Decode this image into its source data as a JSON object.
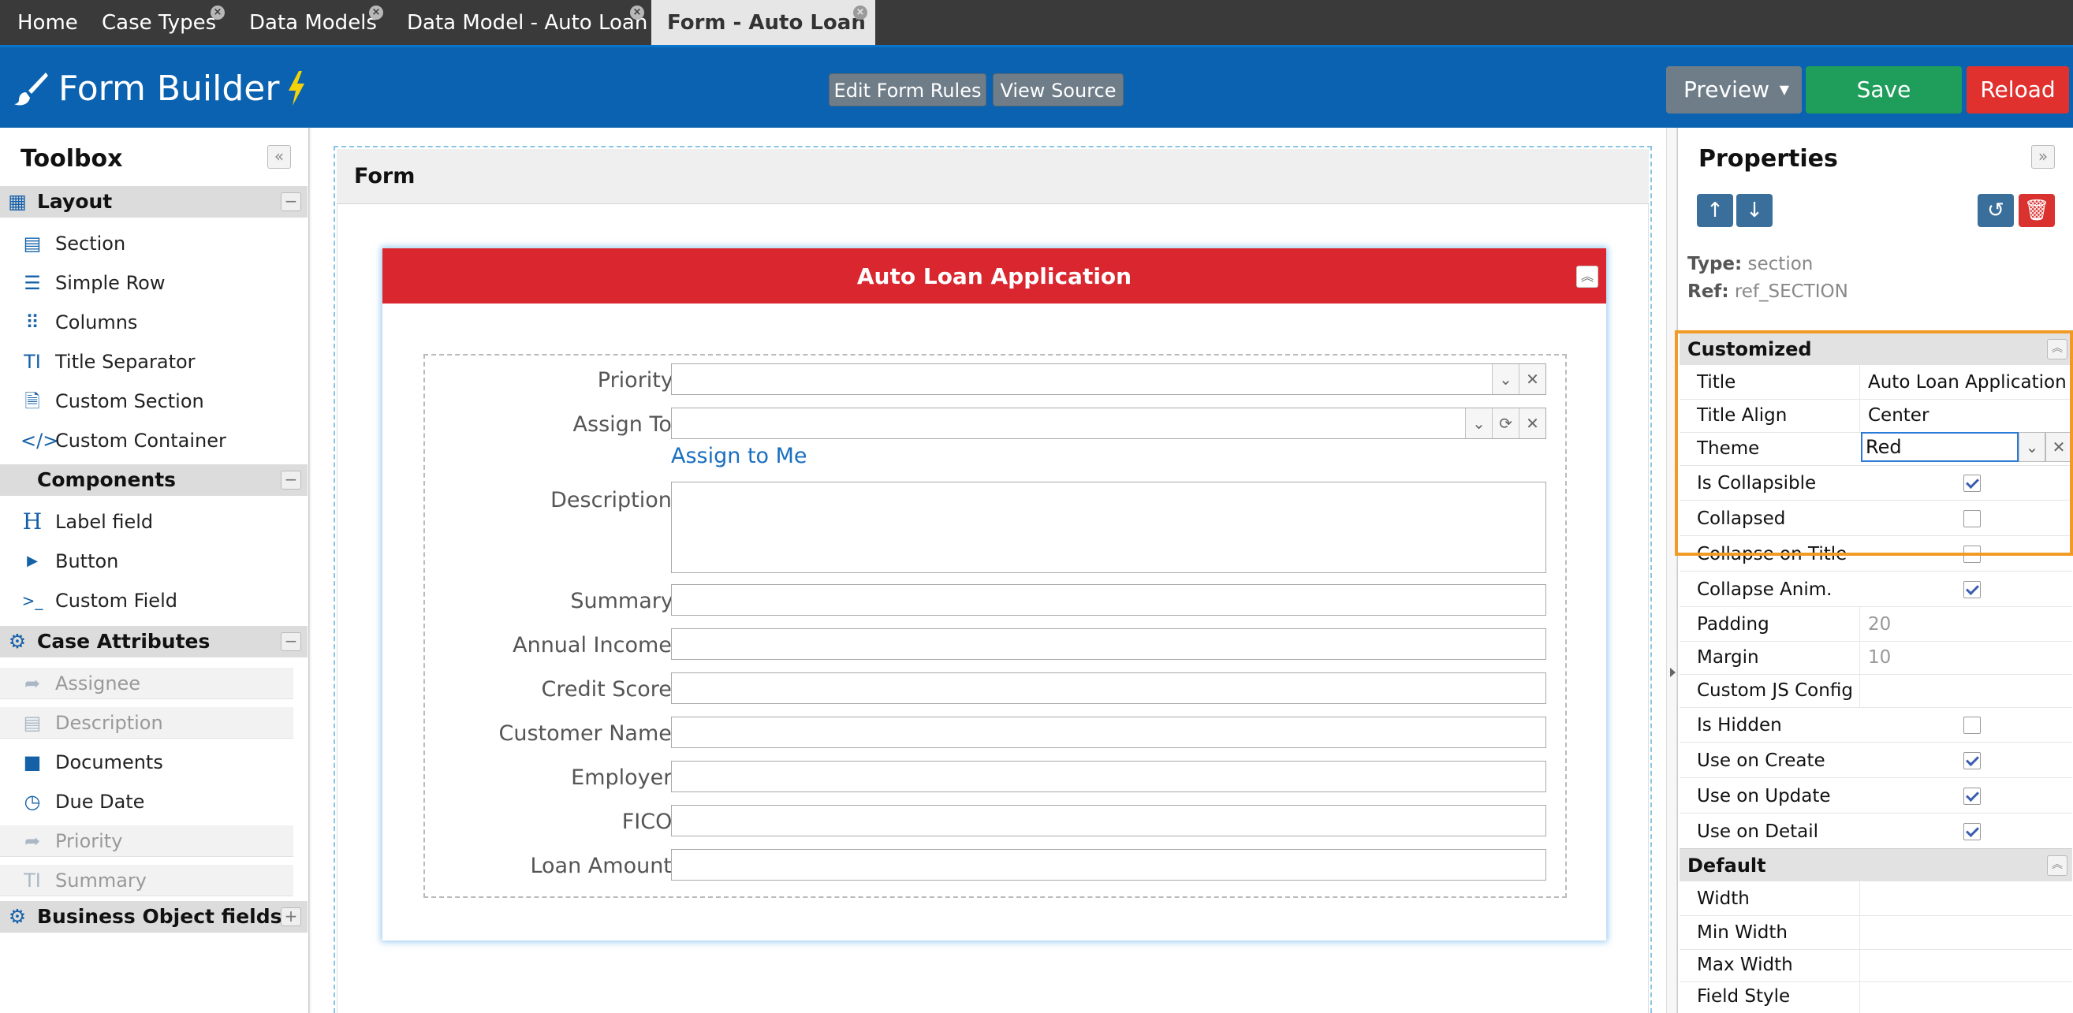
{
  "tabs": [
    {
      "label": "Home"
    },
    {
      "label": "Case Types"
    },
    {
      "label": "Data Models"
    },
    {
      "label": "Data Model - Auto Loan"
    },
    {
      "label": "Form - Auto Loan"
    }
  ],
  "header": {
    "title": "Form Builder",
    "edit_rules": "Edit Form Rules",
    "view_source": "View Source",
    "preview": "Preview",
    "save": "Save",
    "reload": "Reload",
    "colors": {
      "bar": "#0a62b0",
      "save": "#1f9e5b",
      "reload": "#e0312f",
      "preview": "#6f7d89"
    }
  },
  "toolbox": {
    "title": "Toolbox",
    "groups": {
      "layout": {
        "label": "Layout",
        "items": [
          "Section",
          "Simple Row",
          "Columns",
          "Title Separator",
          "Custom Section",
          "Custom Container"
        ]
      },
      "components": {
        "label": "Components",
        "items": [
          "Label field",
          "Button",
          "Custom Field"
        ]
      },
      "case_attributes": {
        "label": "Case Attributes",
        "items": [
          "Assignee",
          "Description",
          "Documents",
          "Due Date",
          "Priority",
          "Summary"
        ]
      },
      "business_object": {
        "label": "Business Object fields"
      }
    }
  },
  "form": {
    "header": "Form",
    "section_title": "Auto Loan Application",
    "section_color": "#d9262f",
    "fields": {
      "priority": "Priority:",
      "assign_to": "Assign To:",
      "assign_to_me": "Assign to Me",
      "description": "Description:",
      "summary": "Summary:",
      "annual_income": "Annual Income:",
      "credit_score": "Credit Score:",
      "customer_name": "Customer Name:",
      "employer": "Employer:",
      "fico": "FICO:",
      "loan_amount": "Loan Amount:"
    }
  },
  "properties": {
    "title": "Properties",
    "type_label": "Type:",
    "type_value": "section",
    "ref_label": "Ref:",
    "ref_value": "ref_SECTION",
    "customized": {
      "label": "Customized",
      "title_name": "Title",
      "title_value": "Auto Loan Application",
      "align_name": "Title Align",
      "align_value": "Center",
      "theme_name": "Theme",
      "theme_value": "Red",
      "is_collapsible": "Is Collapsible",
      "collapsed": "Collapsed",
      "collapse_on_title": "Collapse on Title",
      "collapse_anim": "Collapse Anim.",
      "padding_name": "Padding",
      "padding_value": "20",
      "margin_name": "Margin",
      "margin_value": "10",
      "custom_js": "Custom JS Config",
      "is_hidden": "Is Hidden",
      "use_on_create": "Use on Create",
      "use_on_update": "Use on Update",
      "use_on_detail": "Use on Detail"
    },
    "default": {
      "label": "Default",
      "width": "Width",
      "min_width": "Min Width",
      "max_width": "Max Width",
      "field_style": "Field Style"
    },
    "highlight_color": "#f29a26"
  }
}
